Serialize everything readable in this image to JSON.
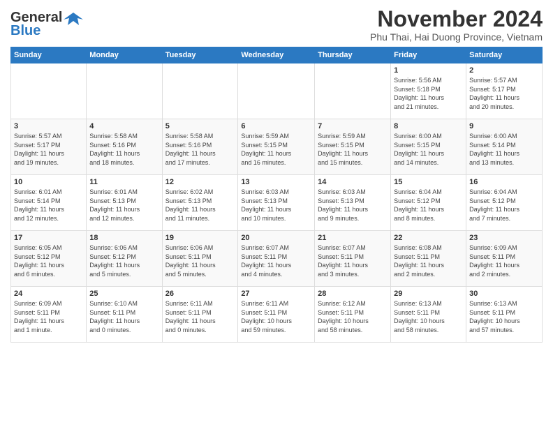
{
  "header": {
    "logo_general": "General",
    "logo_blue": "Blue",
    "month_title": "November 2024",
    "subtitle": "Phu Thai, Hai Duong Province, Vietnam"
  },
  "calendar": {
    "weekdays": [
      "Sunday",
      "Monday",
      "Tuesday",
      "Wednesday",
      "Thursday",
      "Friday",
      "Saturday"
    ],
    "weeks": [
      [
        {
          "day": "",
          "info": ""
        },
        {
          "day": "",
          "info": ""
        },
        {
          "day": "",
          "info": ""
        },
        {
          "day": "",
          "info": ""
        },
        {
          "day": "",
          "info": ""
        },
        {
          "day": "1",
          "info": "Sunrise: 5:56 AM\nSunset: 5:18 PM\nDaylight: 11 hours\nand 21 minutes."
        },
        {
          "day": "2",
          "info": "Sunrise: 5:57 AM\nSunset: 5:17 PM\nDaylight: 11 hours\nand 20 minutes."
        }
      ],
      [
        {
          "day": "3",
          "info": "Sunrise: 5:57 AM\nSunset: 5:17 PM\nDaylight: 11 hours\nand 19 minutes."
        },
        {
          "day": "4",
          "info": "Sunrise: 5:58 AM\nSunset: 5:16 PM\nDaylight: 11 hours\nand 18 minutes."
        },
        {
          "day": "5",
          "info": "Sunrise: 5:58 AM\nSunset: 5:16 PM\nDaylight: 11 hours\nand 17 minutes."
        },
        {
          "day": "6",
          "info": "Sunrise: 5:59 AM\nSunset: 5:15 PM\nDaylight: 11 hours\nand 16 minutes."
        },
        {
          "day": "7",
          "info": "Sunrise: 5:59 AM\nSunset: 5:15 PM\nDaylight: 11 hours\nand 15 minutes."
        },
        {
          "day": "8",
          "info": "Sunrise: 6:00 AM\nSunset: 5:15 PM\nDaylight: 11 hours\nand 14 minutes."
        },
        {
          "day": "9",
          "info": "Sunrise: 6:00 AM\nSunset: 5:14 PM\nDaylight: 11 hours\nand 13 minutes."
        }
      ],
      [
        {
          "day": "10",
          "info": "Sunrise: 6:01 AM\nSunset: 5:14 PM\nDaylight: 11 hours\nand 12 minutes."
        },
        {
          "day": "11",
          "info": "Sunrise: 6:01 AM\nSunset: 5:13 PM\nDaylight: 11 hours\nand 12 minutes."
        },
        {
          "day": "12",
          "info": "Sunrise: 6:02 AM\nSunset: 5:13 PM\nDaylight: 11 hours\nand 11 minutes."
        },
        {
          "day": "13",
          "info": "Sunrise: 6:03 AM\nSunset: 5:13 PM\nDaylight: 11 hours\nand 10 minutes."
        },
        {
          "day": "14",
          "info": "Sunrise: 6:03 AM\nSunset: 5:13 PM\nDaylight: 11 hours\nand 9 minutes."
        },
        {
          "day": "15",
          "info": "Sunrise: 6:04 AM\nSunset: 5:12 PM\nDaylight: 11 hours\nand 8 minutes."
        },
        {
          "day": "16",
          "info": "Sunrise: 6:04 AM\nSunset: 5:12 PM\nDaylight: 11 hours\nand 7 minutes."
        }
      ],
      [
        {
          "day": "17",
          "info": "Sunrise: 6:05 AM\nSunset: 5:12 PM\nDaylight: 11 hours\nand 6 minutes."
        },
        {
          "day": "18",
          "info": "Sunrise: 6:06 AM\nSunset: 5:12 PM\nDaylight: 11 hours\nand 5 minutes."
        },
        {
          "day": "19",
          "info": "Sunrise: 6:06 AM\nSunset: 5:11 PM\nDaylight: 11 hours\nand 5 minutes."
        },
        {
          "day": "20",
          "info": "Sunrise: 6:07 AM\nSunset: 5:11 PM\nDaylight: 11 hours\nand 4 minutes."
        },
        {
          "day": "21",
          "info": "Sunrise: 6:07 AM\nSunset: 5:11 PM\nDaylight: 11 hours\nand 3 minutes."
        },
        {
          "day": "22",
          "info": "Sunrise: 6:08 AM\nSunset: 5:11 PM\nDaylight: 11 hours\nand 2 minutes."
        },
        {
          "day": "23",
          "info": "Sunrise: 6:09 AM\nSunset: 5:11 PM\nDaylight: 11 hours\nand 2 minutes."
        }
      ],
      [
        {
          "day": "24",
          "info": "Sunrise: 6:09 AM\nSunset: 5:11 PM\nDaylight: 11 hours\nand 1 minute."
        },
        {
          "day": "25",
          "info": "Sunrise: 6:10 AM\nSunset: 5:11 PM\nDaylight: 11 hours\nand 0 minutes."
        },
        {
          "day": "26",
          "info": "Sunrise: 6:11 AM\nSunset: 5:11 PM\nDaylight: 11 hours\nand 0 minutes."
        },
        {
          "day": "27",
          "info": "Sunrise: 6:11 AM\nSunset: 5:11 PM\nDaylight: 10 hours\nand 59 minutes."
        },
        {
          "day": "28",
          "info": "Sunrise: 6:12 AM\nSunset: 5:11 PM\nDaylight: 10 hours\nand 58 minutes."
        },
        {
          "day": "29",
          "info": "Sunrise: 6:13 AM\nSunset: 5:11 PM\nDaylight: 10 hours\nand 58 minutes."
        },
        {
          "day": "30",
          "info": "Sunrise: 6:13 AM\nSunset: 5:11 PM\nDaylight: 10 hours\nand 57 minutes."
        }
      ]
    ]
  }
}
